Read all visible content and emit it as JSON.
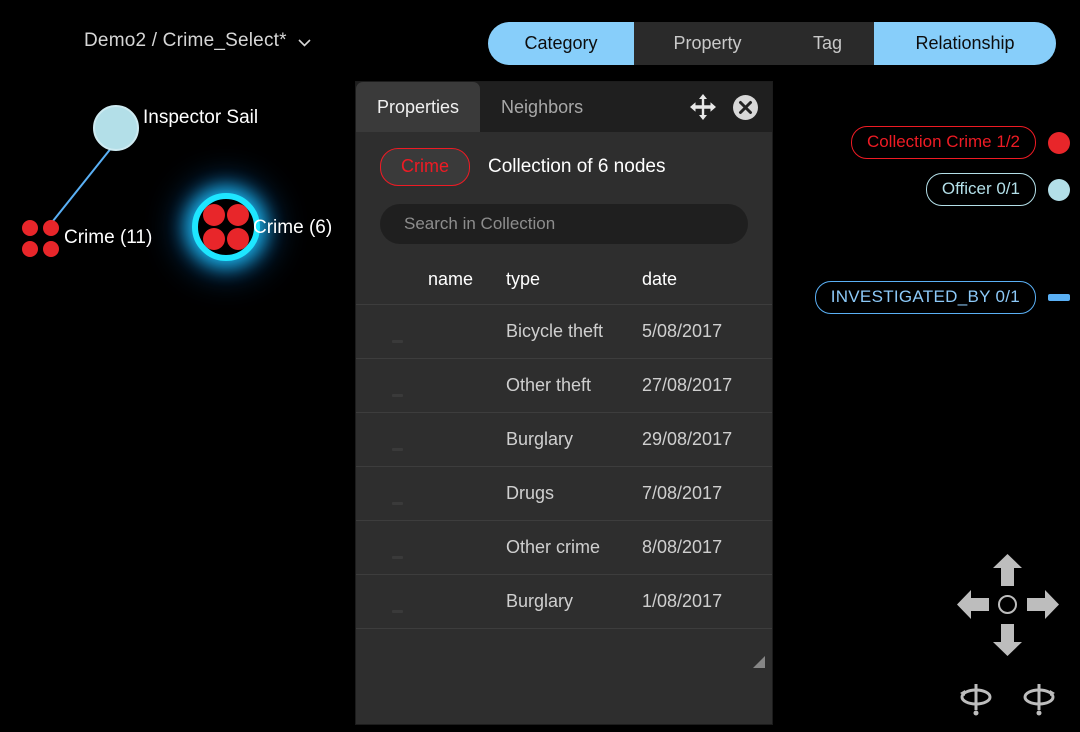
{
  "header": {
    "breadcrumb": "Demo2 / Crime_Select*",
    "chevron_icon": "chevron-down-icon",
    "tabs": [
      {
        "label": "Category",
        "active": true
      },
      {
        "label": "Property",
        "active": false
      },
      {
        "label": "Tag",
        "active": false
      },
      {
        "label": "Relationship",
        "active": true
      }
    ]
  },
  "graph": {
    "nodes": [
      {
        "label": "Inspector Sail",
        "kind": "officer",
        "color": "#b3dfe8"
      },
      {
        "label": "Crime (11)",
        "kind": "crime-cluster",
        "color": "#e8262a"
      },
      {
        "label": "Crime (6)",
        "kind": "crime-cluster-selected",
        "color": "#e8262a",
        "highlight": "#1ee6ff"
      }
    ],
    "edge_color": "#5ab0f5"
  },
  "legend": {
    "categories": [
      {
        "label": "Collection Crime 1/2",
        "color": "#ee1b24",
        "swatch": "circle"
      },
      {
        "label": "Officer 0/1",
        "color": "#b3dfe8",
        "swatch": "circle"
      }
    ],
    "relationships": [
      {
        "label": "INVESTIGATED_BY 0/1",
        "color": "#5ab0f5",
        "swatch": "line"
      }
    ]
  },
  "nav": {
    "up_icon": "arrow-up-icon",
    "down_icon": "arrow-down-icon",
    "left_icon": "arrow-left-icon",
    "right_icon": "arrow-right-icon",
    "center_icon": "recenter-icon",
    "rotate_left_icon": "rotate-left-icon",
    "rotate_right_icon": "rotate-right-icon"
  },
  "panel": {
    "tabs": [
      {
        "label": "Properties",
        "active": true
      },
      {
        "label": "Neighbors",
        "active": false
      }
    ],
    "move_icon": "move-icon",
    "close_icon": "close-icon",
    "badge": "Crime",
    "title": "Collection of 6 nodes",
    "search": {
      "value": "",
      "placeholder": "Search in Collection"
    },
    "columns": [
      "name",
      "type",
      "date"
    ],
    "rows": [
      {
        "remove_icon": "remove-icon",
        "name": "",
        "type": "Bicycle theft",
        "date": "5/08/2017"
      },
      {
        "remove_icon": "remove-icon",
        "name": "",
        "type": "Other theft",
        "date": "27/08/2017"
      },
      {
        "remove_icon": "remove-icon",
        "name": "",
        "type": "Burglary",
        "date": "29/08/2017"
      },
      {
        "remove_icon": "remove-icon",
        "name": "",
        "type": "Drugs",
        "date": "7/08/2017"
      },
      {
        "remove_icon": "remove-icon",
        "name": "",
        "type": "Other crime",
        "date": "8/08/2017"
      },
      {
        "remove_icon": "remove-icon",
        "name": "",
        "type": "Burglary",
        "date": "1/08/2017"
      }
    ],
    "resize_icon": "resize-grip-icon"
  }
}
